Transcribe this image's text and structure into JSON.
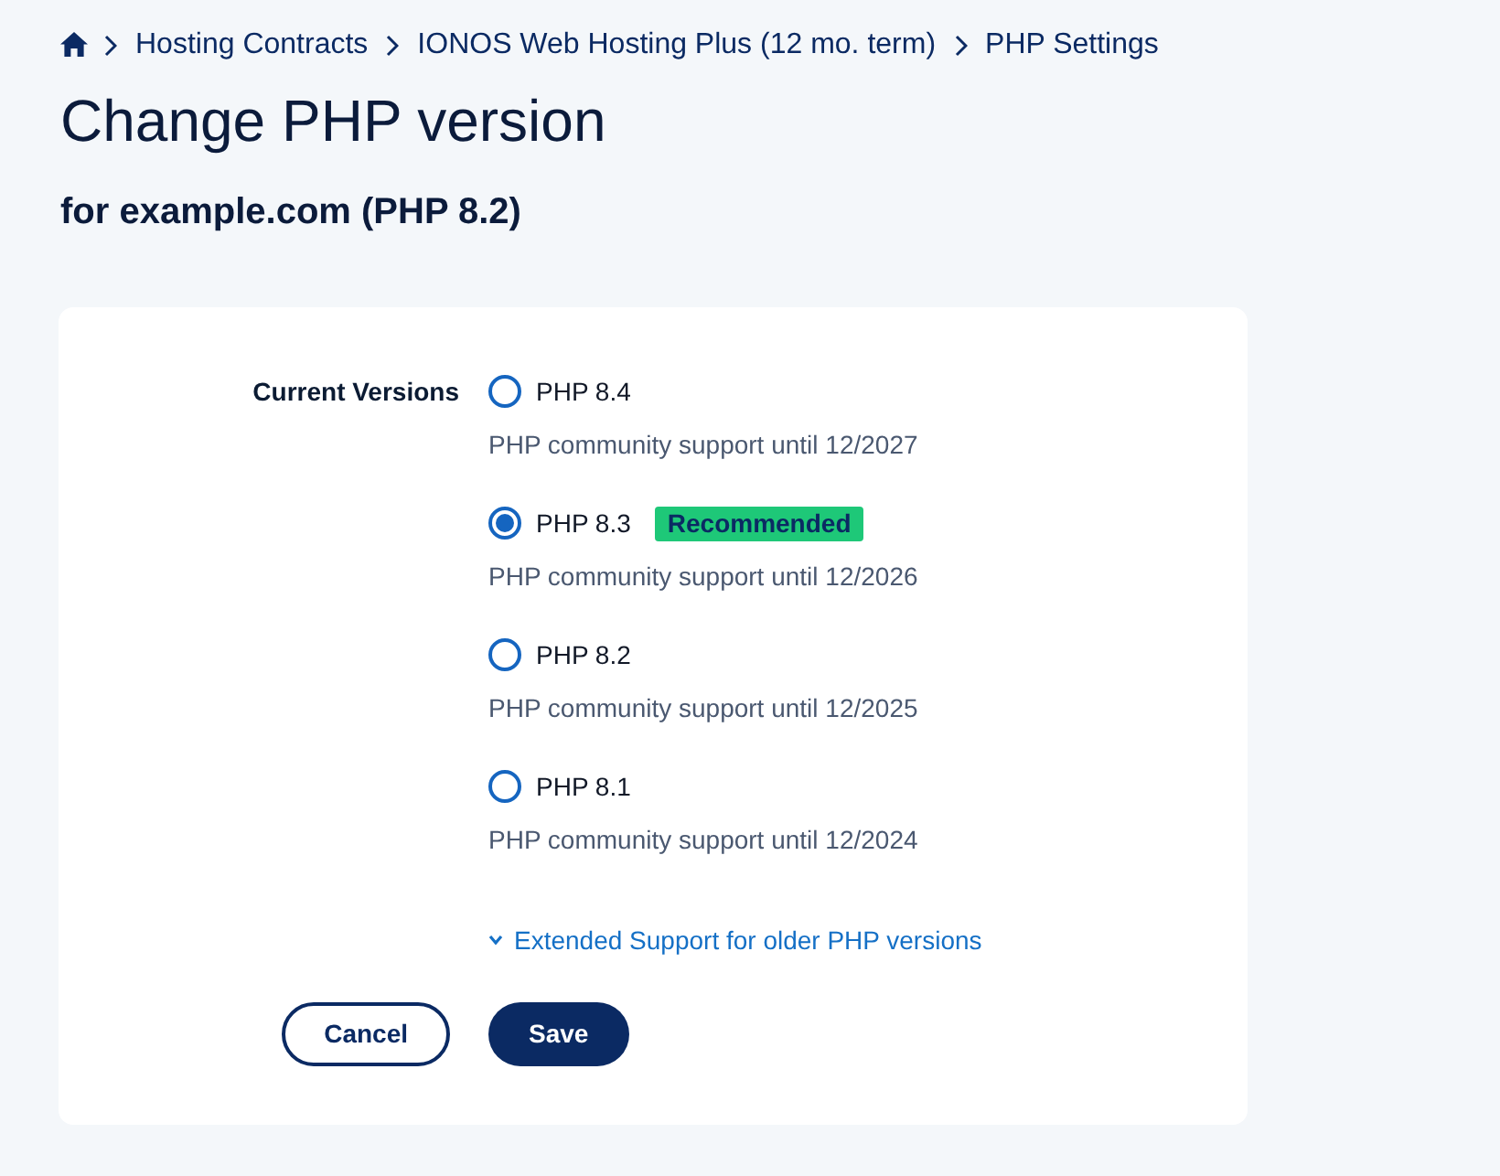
{
  "breadcrumb": {
    "items": [
      "Hosting Contracts",
      "IONOS Web Hosting Plus (12 mo. term)",
      "PHP Settings"
    ]
  },
  "title": "Change PHP version",
  "subtitle": "for example.com (PHP 8.2)",
  "form": {
    "label": "Current Versions",
    "options": [
      {
        "label": "PHP 8.4",
        "selected": false,
        "description": "PHP community support until 12/2027"
      },
      {
        "label": "PHP 8.3",
        "selected": true,
        "badge": "Recommended",
        "description": "PHP community support until 12/2026"
      },
      {
        "label": "PHP 8.2",
        "selected": false,
        "description": "PHP community support until 12/2025"
      },
      {
        "label": "PHP 8.1",
        "selected": false,
        "description": "PHP community support until 12/2024"
      }
    ],
    "extended_link": {
      "label": "Extended Support for older PHP versions",
      "expanded": false
    },
    "buttons": [
      {
        "label": "Cancel",
        "kind": "secondary"
      },
      {
        "label": "Save",
        "kind": "primary"
      }
    ]
  }
}
